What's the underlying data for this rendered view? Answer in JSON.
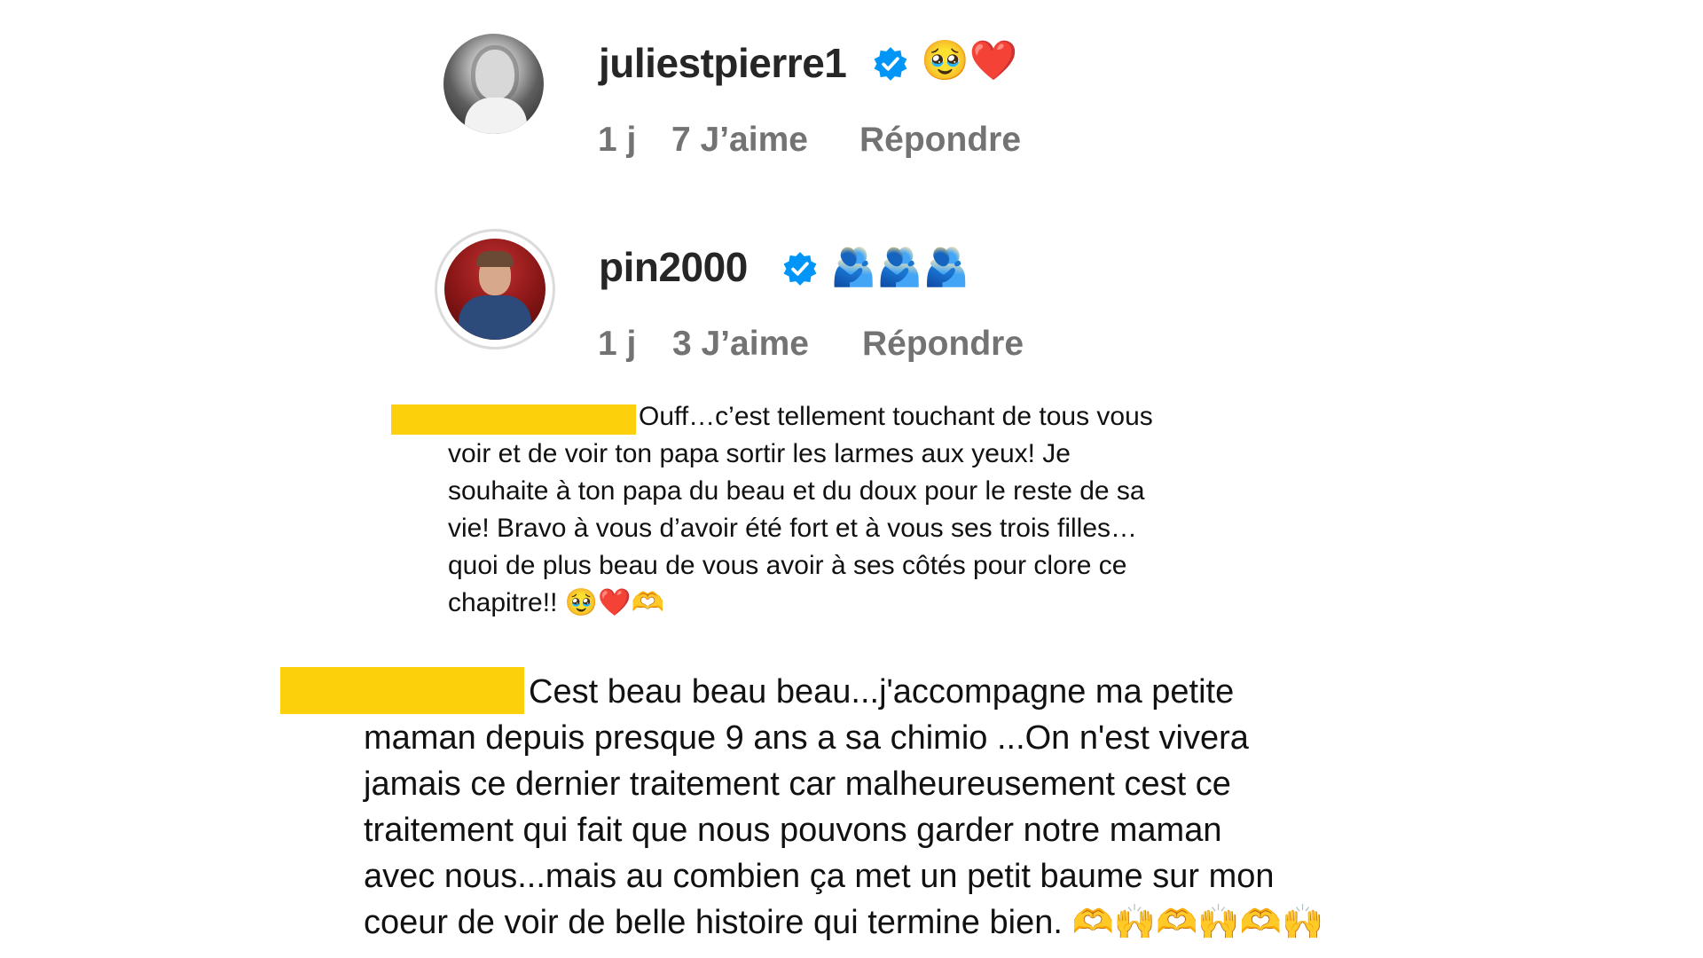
{
  "comments": [
    {
      "username": "juliestpierre1",
      "verified": true,
      "reaction_emoji": "🥹❤️",
      "time": "1 j",
      "likes": "7 J’aime",
      "reply": "Répondre"
    },
    {
      "username": "pin2000",
      "verified": true,
      "reaction_emoji": "🫂🫂🫂",
      "time": "1 j",
      "likes": "3 J’aime",
      "reply": "Répondre"
    }
  ],
  "messages": [
    {
      "redacted_name": true,
      "lines": [
        "Ouff…c’est tellement touchant de tous vous",
        "voir et de voir ton papa sortir les larmes aux yeux! Je",
        "souhaite à ton papa du beau et du doux pour le reste de sa",
        "vie! Bravo à vous d’avoir été fort et à vous ses trois filles…",
        "quoi de plus beau de vous avoir à ses côtés pour clore ce",
        "chapitre!! 🥹❤️🫶"
      ]
    },
    {
      "redacted_name": true,
      "lines": [
        "Cest beau beau beau...j'accompagne ma petite",
        "maman depuis presque 9 ans a sa chimio ...On n'est vivera",
        "jamais ce dernier traitement car malheureusement cest ce",
        "traitement qui fait que nous pouvons garder notre maman",
        "avec nous...mais au combien ça met un petit baume sur mon",
        "coeur de voir de belle histoire qui termine bien. 🫶🙌🫶🙌🫶🙌"
      ]
    }
  ],
  "colors": {
    "verified_badge": "#0095f6",
    "redaction_highlight": "#fdd00c",
    "meta_text": "#737373",
    "username_text": "#262626"
  },
  "icons": {
    "verified": "verified-badge-icon"
  }
}
